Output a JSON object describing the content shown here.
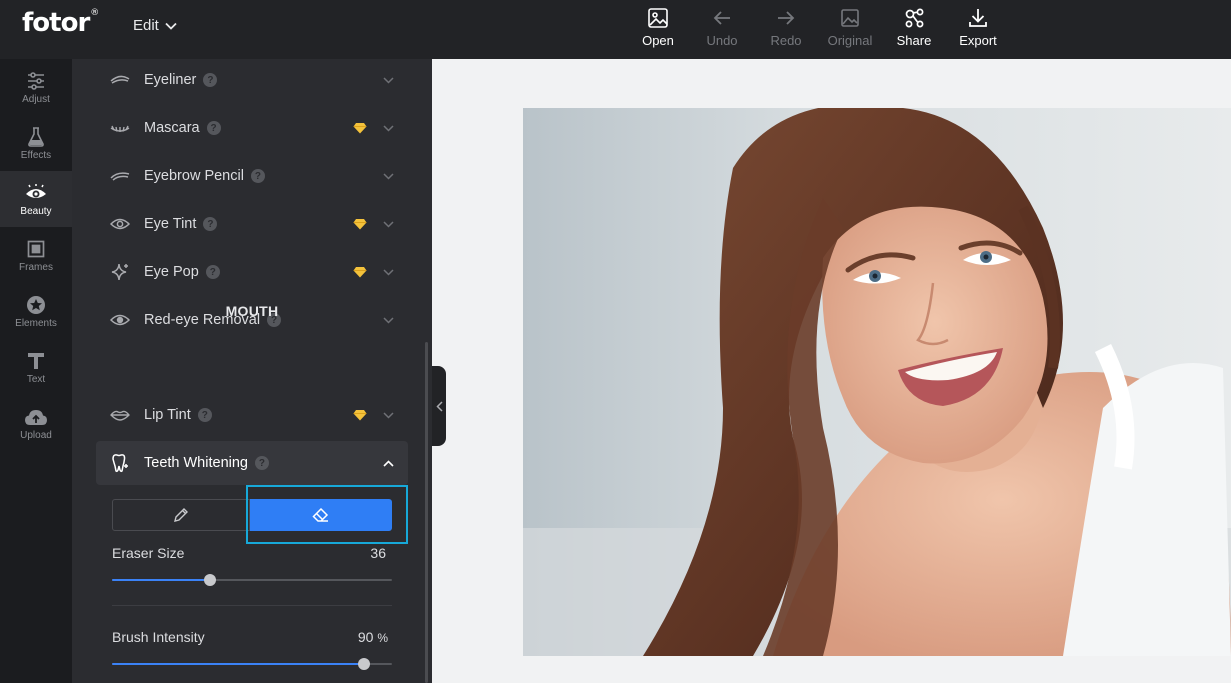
{
  "app": {
    "logo": "fotor",
    "logo_mark": "®",
    "edit_menu": "Edit"
  },
  "toolbar": [
    {
      "label": "Open",
      "icon": "open-image-icon",
      "enabled": true
    },
    {
      "label": "Undo",
      "icon": "undo-arrow-icon",
      "enabled": false
    },
    {
      "label": "Redo",
      "icon": "redo-arrow-icon",
      "enabled": false
    },
    {
      "label": "Original",
      "icon": "original-image-icon",
      "enabled": false
    },
    {
      "label": "Share",
      "icon": "share-icon",
      "enabled": true
    },
    {
      "label": "Export",
      "icon": "export-download-icon",
      "enabled": true
    }
  ],
  "nav": [
    {
      "label": "Adjust",
      "icon": "sliders-icon",
      "active": false
    },
    {
      "label": "Effects",
      "icon": "flask-icon",
      "active": false
    },
    {
      "label": "Beauty",
      "icon": "eye-icon",
      "active": true
    },
    {
      "label": "Frames",
      "icon": "frame-icon",
      "active": false
    },
    {
      "label": "Elements",
      "icon": "star-icon",
      "active": false
    },
    {
      "label": "Text",
      "icon": "text-t-icon",
      "active": false
    },
    {
      "label": "Upload",
      "icon": "cloud-upload-icon",
      "active": false
    }
  ],
  "panel": {
    "tools": [
      {
        "label": "Eyeliner",
        "icon": "eyeliner-icon",
        "premium": false
      },
      {
        "label": "Mascara",
        "icon": "mascara-lashes-icon",
        "premium": true
      },
      {
        "label": "Eyebrow Pencil",
        "icon": "eyebrow-icon",
        "premium": false
      },
      {
        "label": "Eye Tint",
        "icon": "eye-outline-icon",
        "premium": true
      },
      {
        "label": "Eye Pop",
        "icon": "sparkle-icon",
        "premium": true
      },
      {
        "label": "Red-eye Removal",
        "icon": "eye-filled-icon",
        "premium": false
      }
    ],
    "section_mouth": "MOUTH",
    "lip_tint": {
      "label": "Lip Tint",
      "icon": "lips-icon",
      "premium": true
    },
    "teeth_whitening": {
      "label": "Teeth Whitening",
      "icon": "tooth-sparkle-icon",
      "expanded": true,
      "mode": "eraser",
      "eraser_size": {
        "label": "Eraser Size",
        "value": "36",
        "fraction": 0.35
      },
      "brush_intensity": {
        "label": "Brush Intensity",
        "value": "90",
        "unit": "%",
        "fraction": 0.9
      }
    }
  },
  "colors": {
    "accent": "#2f7ef5",
    "highlight": "#17a9d9",
    "gem": "#f4c23b"
  }
}
